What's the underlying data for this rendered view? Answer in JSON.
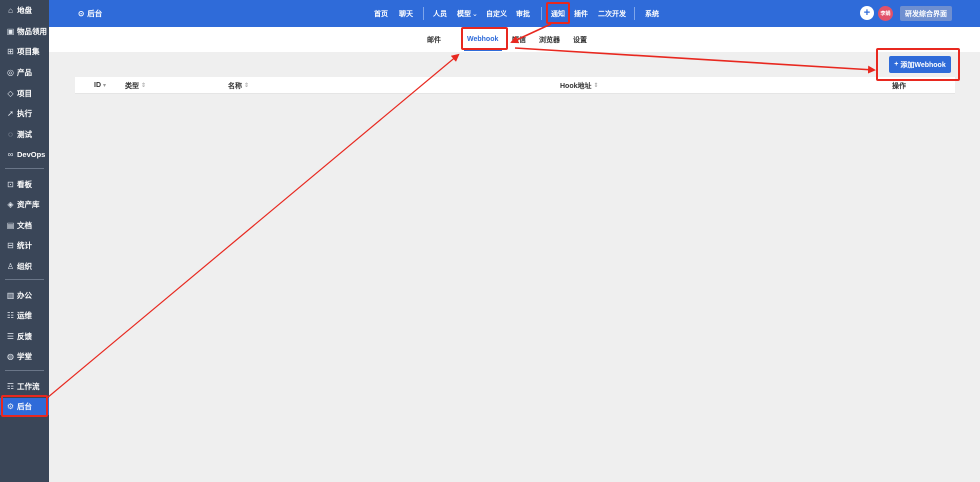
{
  "sidebar": {
    "items": [
      {
        "icon": "home-icon",
        "glyph": "⌂",
        "label": "地盘"
      },
      {
        "icon": "box-icon",
        "glyph": "▣",
        "label": "物品领用"
      },
      {
        "icon": "grid-icon",
        "glyph": "⊞",
        "label": "项目集"
      },
      {
        "icon": "location-icon",
        "glyph": "◎",
        "label": "产品"
      },
      {
        "icon": "diamond-icon",
        "glyph": "◇",
        "label": "项目"
      },
      {
        "icon": "rocket-icon",
        "glyph": "➚",
        "label": "执行"
      },
      {
        "icon": "test-icon",
        "glyph": "◌",
        "label": "测试"
      },
      {
        "icon": "devops-icon",
        "glyph": "∞",
        "label": "DevOps"
      },
      {
        "icon": "board-icon",
        "glyph": "⊡",
        "label": "看板"
      },
      {
        "icon": "asset-icon",
        "glyph": "◈",
        "label": "资产库"
      },
      {
        "icon": "document-icon",
        "glyph": "▤",
        "label": "文档"
      },
      {
        "icon": "stats-icon",
        "glyph": "⊟",
        "label": "统计"
      },
      {
        "icon": "org-icon",
        "glyph": "♙",
        "label": "组织"
      },
      {
        "icon": "office-icon",
        "glyph": "▥",
        "label": "办公"
      },
      {
        "icon": "ops-icon",
        "glyph": "☷",
        "label": "运维"
      },
      {
        "icon": "feedback-icon",
        "glyph": "☰",
        "label": "反馈"
      },
      {
        "icon": "academy-icon",
        "glyph": "◍",
        "label": "学堂"
      },
      {
        "icon": "workflow-icon",
        "glyph": "☶",
        "label": "工作流"
      },
      {
        "icon": "admin-icon",
        "glyph": "⚙",
        "label": "后台"
      }
    ]
  },
  "topbar": {
    "back_label": "后台",
    "nav": [
      "首页",
      "聊天",
      "人员",
      "模型",
      "自定义",
      "审批",
      "通知",
      "插件",
      "二次开发",
      "系统"
    ],
    "model_caret": "⌄",
    "avatar_text": "李娟",
    "workspace_label": "研发综合界面"
  },
  "subtabs": [
    "邮件",
    "Webhook",
    "短信",
    "浏览器",
    "设置"
  ],
  "add_button": {
    "plus": "+",
    "label": "添加Webhook"
  },
  "table": {
    "headers": [
      "ID",
      "类型",
      "名称",
      "Hook地址",
      "操作"
    ],
    "id_sort": "▾",
    "sort_glyph": "⇕"
  },
  "colors": {
    "primary": "#2f6bd9",
    "sidebar": "#3a4658",
    "annotation": "#e8281f"
  }
}
